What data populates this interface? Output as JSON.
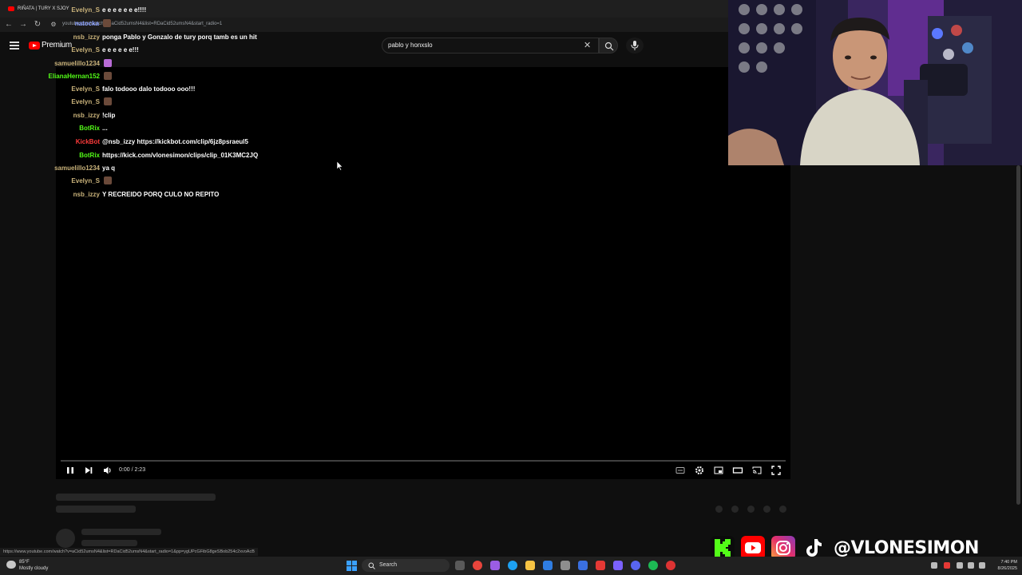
{
  "browser": {
    "tab_title": "RIÑATA | TURY X SJOY",
    "url": "youtube.com/watch?v=aCid52umsN4&list=RDaCid52umsN4&start_radio=1",
    "status_url": "https://www.youtube.com/watch?v=aCid52umsN4&list=RDaCid52umsN4&start_radio=1&pp=ygUPcGFibG8geSBob254c2xvoAcB"
  },
  "youtube": {
    "premium_label": "Premium",
    "search_query": "pablo y honxslo",
    "time_display": "0:00 / 2:23",
    "progress": 0.0
  },
  "chat": [
    {
      "name": "Evelyn_S",
      "message": "e e e e e e e!!!!",
      "name_color": "#c9b27a"
    },
    {
      "name": "natocka",
      "message": "",
      "name_color": "#8aa0ff"
    },
    {
      "name": "nsb_izzy",
      "message": "ponga Pablo y Gonzalo de tury porq tamb es un hit",
      "name_color": "#c9b27a"
    },
    {
      "name": "Evelyn_S",
      "message": "e e e e e e!!!",
      "name_color": "#c9b27a"
    },
    {
      "name": "samuelillo1234",
      "message": "",
      "name_color": "#c9b27a"
    },
    {
      "name": "ElianaHernan152",
      "message": "",
      "name_color": "#53fc18"
    },
    {
      "name": "Evelyn_S",
      "message": "falo todooo dalo todooo ooo!!!",
      "name_color": "#c9b27a"
    },
    {
      "name": "Evelyn_S",
      "message": "",
      "name_color": "#c9b27a"
    },
    {
      "name": "nsb_izzy",
      "message": "!clip",
      "name_color": "#c9b27a"
    },
    {
      "name": "BotRix",
      "message": "...",
      "name_color": "#53fc18"
    },
    {
      "name": "KickBot",
      "message": "@nsb_izzy https://kickbot.com/clip/6jz8psraeul5",
      "name_color": "#ff3b3b"
    },
    {
      "name": "BotRix",
      "message": "https://kick.com/vlonesimon/clips/clip_01K3MC2JQ",
      "name_color": "#53fc18"
    },
    {
      "name": "samuelillo1234",
      "message": "ya q",
      "name_color": "#c9b27a"
    },
    {
      "name": "Evelyn_S",
      "message": "",
      "name_color": "#c9b27a"
    },
    {
      "name": "nsb_izzy",
      "message": "Y RECREIDO PORQ CULO NO REPITO",
      "name_color": "#c9b27a"
    }
  ],
  "overlay": {
    "handle": "@VLONESIMON"
  },
  "taskbar": {
    "weather_temp": "85°F",
    "weather_desc": "Mostly cloudy",
    "search_label": "Search",
    "time": "7:40 PM",
    "date": "8/26/2025"
  },
  "colors": {
    "youtube_red": "#ff0000",
    "kick_green": "#53fc18",
    "background": "#0f0f0f"
  }
}
